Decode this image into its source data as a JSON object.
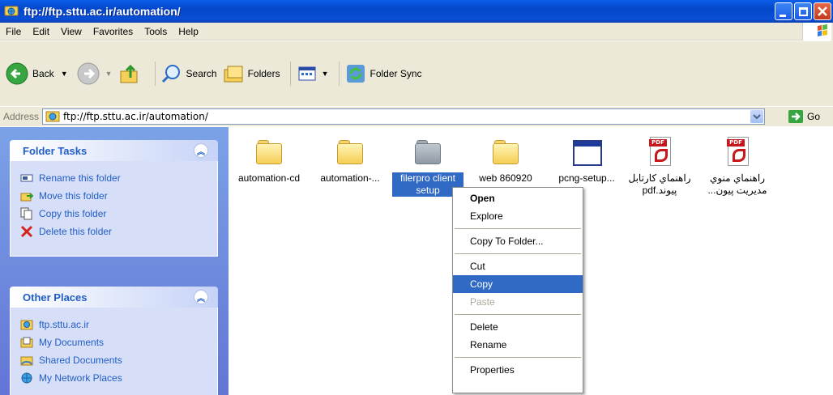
{
  "window": {
    "title": "ftp://ftp.sttu.ac.ir/automation/"
  },
  "menu": [
    "File",
    "Edit",
    "View",
    "Favorites",
    "Tools",
    "Help"
  ],
  "toolbar": {
    "back": "Back",
    "search": "Search",
    "folders": "Folders",
    "folder_sync": "Folder Sync"
  },
  "address": {
    "label": "Address",
    "value": "ftp://ftp.sttu.ac.ir/automation/",
    "go": "Go"
  },
  "folder_tasks": {
    "title": "Folder Tasks",
    "items": [
      "Rename this folder",
      "Move this folder",
      "Copy this folder",
      "Delete this folder"
    ]
  },
  "other_places": {
    "title": "Other Places",
    "items": [
      "ftp.sttu.ac.ir",
      "My Documents",
      "Shared Documents",
      "My Network Places"
    ]
  },
  "files": [
    {
      "name": "automation-cd",
      "type": "folder"
    },
    {
      "name": "automation-...",
      "type": "folder"
    },
    {
      "name": "filerpro client setup",
      "type": "folder",
      "selected": true
    },
    {
      "name": "web 860920",
      "type": "folder"
    },
    {
      "name": "pcng-setup...",
      "type": "app"
    },
    {
      "name": "راهنماي كارتابل پيوند.pdf",
      "type": "pdf"
    },
    {
      "name": "راهنماي منوي مديريت پيون...",
      "type": "pdf"
    }
  ],
  "context_menu": {
    "items": [
      "Open",
      "Explore",
      "Copy To Folder...",
      "Cut",
      "Copy",
      "Paste",
      "Delete",
      "Rename",
      "Properties"
    ]
  },
  "colors": {
    "titlebar": "#0a4fd6",
    "selection": "#316ac5",
    "task_link": "#215dc6"
  }
}
